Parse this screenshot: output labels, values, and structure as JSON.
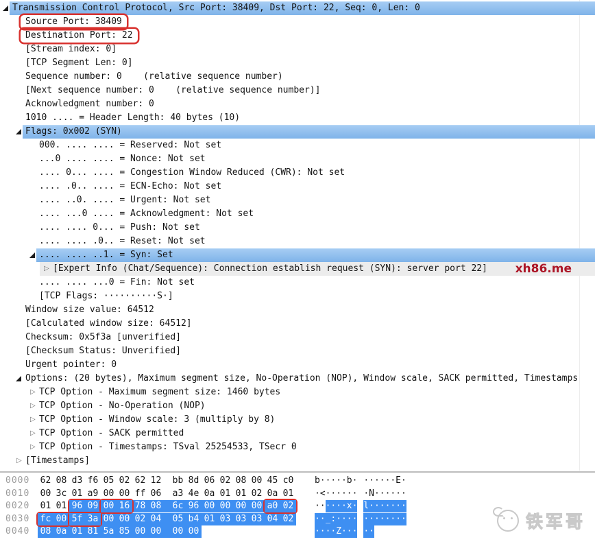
{
  "colors": {
    "selection_blue": "#7fb3e9",
    "selection_blue_light": "#a5ccf3",
    "hex_highlight_blue": "#3e8ff2",
    "annotation_red": "#d8312e",
    "expert_chat_gray": "#ececec",
    "watermark_red": "#ac1526",
    "brand_gray": "#c9c9c9"
  },
  "icons": {
    "expander_collapsed": "▷"
  },
  "watermarks": {
    "site": "xh86.me",
    "brand": "铁军哥"
  },
  "tree": {
    "rows": [
      {
        "t": "Transmission Control Protocol, Src Port: 38409, Dst Port: 22, Seq: 0, Len: 0",
        "lv": 0,
        "a": "open",
        "sel": true
      },
      {
        "t": "Source Port: 38409",
        "lv": 1,
        "box": true
      },
      {
        "t": "Destination Port: 22",
        "lv": 1,
        "box": true
      },
      {
        "t": "[Stream index: 0]",
        "lv": 1
      },
      {
        "t": "[TCP Segment Len: 0]",
        "lv": 1
      },
      {
        "t": "Sequence number: 0    (relative sequence number)",
        "lv": 1
      },
      {
        "t": "[Next sequence number: 0    (relative sequence number)]",
        "lv": 1
      },
      {
        "t": "Acknowledgment number: 0",
        "lv": 1
      },
      {
        "t": "1010 .... = Header Length: 40 bytes (10)",
        "lv": 1
      },
      {
        "t": "Flags: 0x002 (SYN)",
        "lv": 1,
        "a": "open",
        "sel": true
      },
      {
        "t": "000. .... .... = Reserved: Not set",
        "lv": 2
      },
      {
        "t": "...0 .... .... = Nonce: Not set",
        "lv": 2
      },
      {
        "t": ".... 0... .... = Congestion Window Reduced (CWR): Not set",
        "lv": 2
      },
      {
        "t": ".... .0.. .... = ECN-Echo: Not set",
        "lv": 2
      },
      {
        "t": ".... ..0. .... = Urgent: Not set",
        "lv": 2
      },
      {
        "t": ".... ...0 .... = Acknowledgment: Not set",
        "lv": 2
      },
      {
        "t": ".... .... 0... = Push: Not set",
        "lv": 2
      },
      {
        "t": ".... .... .0.. = Reset: Not set",
        "lv": 2
      },
      {
        "t": ".... .... ..1. = Syn: Set",
        "lv": 2,
        "a": "open",
        "sel": true
      },
      {
        "t": "[Expert Info (Chat/Sequence): Connection establish request (SYN): server port 22]",
        "lv": 3,
        "a": "closed",
        "expert": true,
        "wm": true
      },
      {
        "t": ".... .... ...0 = Fin: Not set",
        "lv": 2
      },
      {
        "t": "[TCP Flags: ··········S·]",
        "lv": 2
      },
      {
        "t": "Window size value: 64512",
        "lv": 1
      },
      {
        "t": "[Calculated window size: 64512]",
        "lv": 1
      },
      {
        "t": "Checksum: 0x5f3a [unverified]",
        "lv": 1
      },
      {
        "t": "[Checksum Status: Unverified]",
        "lv": 1
      },
      {
        "t": "Urgent pointer: 0",
        "lv": 1
      },
      {
        "t": "Options: (20 bytes), Maximum segment size, No-Operation (NOP), Window scale, SACK permitted, Timestamps",
        "lv": 1,
        "a": "open"
      },
      {
        "t": "TCP Option - Maximum segment size: 1460 bytes",
        "lv": 2,
        "a": "closed"
      },
      {
        "t": "TCP Option - No-Operation (NOP)",
        "lv": 2,
        "a": "closed"
      },
      {
        "t": "TCP Option - Window scale: 3 (multiply by 8)",
        "lv": 2,
        "a": "closed"
      },
      {
        "t": "TCP Option - SACK permitted",
        "lv": 2,
        "a": "closed"
      },
      {
        "t": "TCP Option - Timestamps: TSval 25254533, TSecr 0",
        "lv": 2,
        "a": "closed"
      },
      {
        "t": "[Timestamps]",
        "lv": 1,
        "a": "closed"
      }
    ]
  },
  "hex": {
    "rows": [
      {
        "offset": "0000",
        "bytes": [
          "62",
          "08",
          "d3",
          "f6",
          "05",
          "02",
          "62",
          "12",
          "bb",
          "8d",
          "06",
          "02",
          "08",
          "00",
          "45",
          "c0"
        ],
        "ascii": "b·····b·······E·",
        "hl": null,
        "red": []
      },
      {
        "offset": "0010",
        "bytes": [
          "00",
          "3c",
          "01",
          "a9",
          "00",
          "00",
          "ff",
          "06",
          "a3",
          "4e",
          "0a",
          "01",
          "01",
          "02",
          "0a",
          "01"
        ],
        "ascii": "·<·······N······",
        "hl": null,
        "red": []
      },
      {
        "offset": "0020",
        "bytes": [
          "01",
          "01",
          "96",
          "09",
          "00",
          "16",
          "78",
          "08",
          "6c",
          "96",
          "00",
          "00",
          "00",
          "00",
          "a0",
          "02"
        ],
        "ascii": "······x·l·······",
        "hl": 2,
        "red": [
          [
            2,
            3
          ],
          [
            4,
            5
          ],
          [
            14,
            15
          ]
        ]
      },
      {
        "offset": "0030",
        "bytes": [
          "fc",
          "00",
          "5f",
          "3a",
          "00",
          "00",
          "02",
          "04",
          "05",
          "b4",
          "01",
          "03",
          "03",
          "03",
          "04",
          "02"
        ],
        "ascii": "··_:············",
        "hl": 0,
        "red": [
          [
            0,
            1
          ],
          [
            2,
            3
          ]
        ]
      },
      {
        "offset": "0040",
        "bytes": [
          "08",
          "0a",
          "01",
          "81",
          "5a",
          "85",
          "00",
          "00",
          "00",
          "00"
        ],
        "ascii": "····Z·····",
        "hl": 0,
        "red": []
      }
    ]
  }
}
